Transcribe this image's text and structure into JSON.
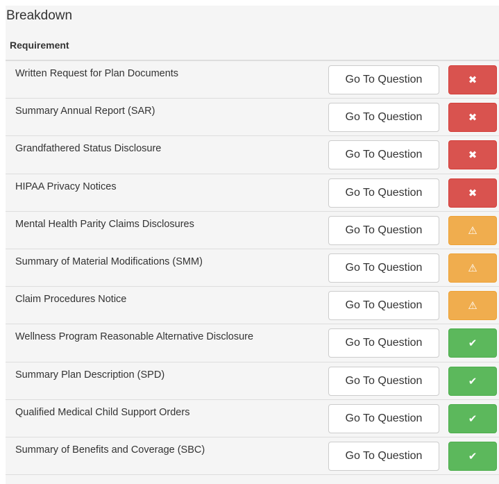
{
  "panel": {
    "title": "Breakdown",
    "column_header": "Requirement"
  },
  "status_colors": {
    "fail": "#d9534f",
    "warn": "#f0ad4e",
    "pass": "#5cb85c"
  },
  "rows": [
    {
      "label": "Written Request for Plan Documents",
      "button": "Go To Question",
      "status": "fail",
      "icon": "close-icon",
      "glyph": "✖"
    },
    {
      "label": "Summary Annual Report (SAR)",
      "button": "Go To Question",
      "status": "fail",
      "icon": "close-icon",
      "glyph": "✖"
    },
    {
      "label": "Grandfathered Status Disclosure",
      "button": "Go To Question",
      "status": "fail",
      "icon": "close-icon",
      "glyph": "✖"
    },
    {
      "label": "HIPAA Privacy Notices",
      "button": "Go To Question",
      "status": "fail",
      "icon": "close-icon",
      "glyph": "✖"
    },
    {
      "label": "Mental Health Parity Claims Disclosures",
      "button": "Go To Question",
      "status": "warn",
      "icon": "warning-icon",
      "glyph": "⚠"
    },
    {
      "label": "Summary of Material Modifications (SMM)",
      "button": "Go To Question",
      "status": "warn",
      "icon": "warning-icon",
      "glyph": "⚠"
    },
    {
      "label": "Claim Procedures Notice",
      "button": "Go To Question",
      "status": "warn",
      "icon": "warning-icon",
      "glyph": "⚠"
    },
    {
      "label": "Wellness Program Reasonable Alternative Disclosure",
      "button": "Go To Question",
      "status": "pass",
      "icon": "check-icon",
      "glyph": "✔"
    },
    {
      "label": "Summary Plan Description (SPD)",
      "button": "Go To Question",
      "status": "pass",
      "icon": "check-icon",
      "glyph": "✔"
    },
    {
      "label": "Qualified Medical Child Support Orders",
      "button": "Go To Question",
      "status": "pass",
      "icon": "check-icon",
      "glyph": "✔"
    },
    {
      "label": "Summary of Benefits and Coverage (SBC)",
      "button": "Go To Question",
      "status": "pass",
      "icon": "check-icon",
      "glyph": "✔"
    }
  ]
}
